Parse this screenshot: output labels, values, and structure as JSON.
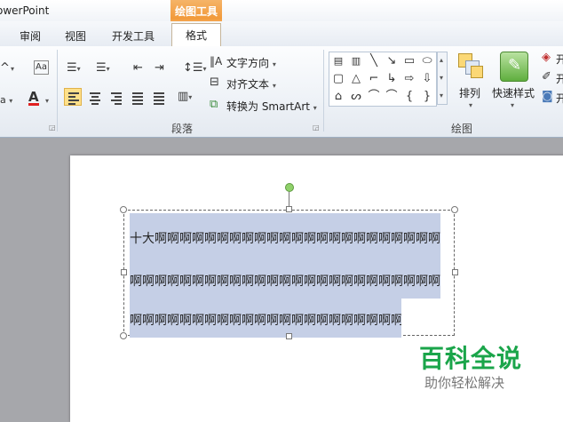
{
  "window": {
    "title": "owerPoint"
  },
  "context_tab_group": {
    "label": "绘图工具"
  },
  "tabs": [
    {
      "label": "审阅"
    },
    {
      "label": "视图"
    },
    {
      "label": "开发工具"
    },
    {
      "label": "格式"
    }
  ],
  "ribbon": {
    "paragraph": {
      "label": "段落",
      "text_direction": "文字方向",
      "align_text": "对齐文本",
      "convert_smartart": "转换为 SmartArt"
    },
    "drawing": {
      "label": "绘图",
      "arrange": "排列",
      "quick_styles": "快速样式",
      "right_items": [
        "开",
        "开",
        "开"
      ]
    }
  },
  "slide": {
    "text_lines": [
      "十大啊啊啊啊啊啊啊啊啊啊啊啊啊啊啊啊啊啊啊啊啊啊啊啊",
      "啊啊啊啊啊啊啊啊啊啊啊啊啊啊啊啊啊啊啊啊啊啊啊啊啊啊",
      "啊啊啊啊啊啊啊啊啊啊啊啊啊啊啊啊啊啊啊啊啊啊"
    ]
  },
  "watermark": {
    "title": "百科全说",
    "subtitle": "助你轻松解决"
  },
  "colors": {
    "accent_orange": "#f29a3a",
    "selection": "#c5cfe6",
    "watermark_green": "#1aa54a"
  }
}
